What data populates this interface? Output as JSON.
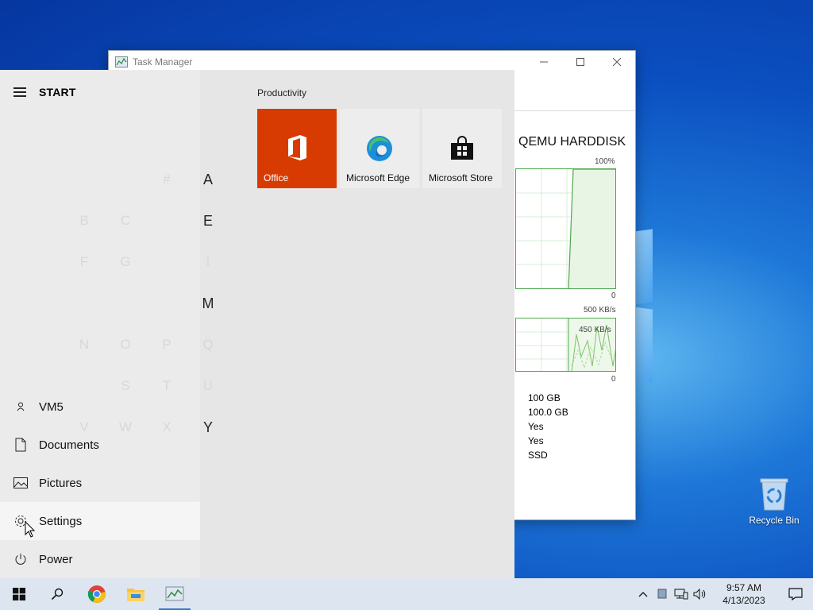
{
  "desktop": {
    "recycle_bin_label": "Recycle Bin"
  },
  "task_manager": {
    "title": "Task Manager",
    "disk_title": "QEMU HARDDISK",
    "graph1_max": "100%",
    "graph1_min": "0",
    "graph2_max": "500 KB/s",
    "graph2_mid": "450 KB/s",
    "graph2_min": "0",
    "properties": [
      "100 GB",
      "100.0 GB",
      "Yes",
      "Yes",
      "SSD"
    ]
  },
  "start_menu": {
    "title": "START",
    "letters_active": [
      "A",
      "E",
      "I",
      "M",
      "Q",
      "U",
      "Y"
    ],
    "letters_dim": [
      "#",
      "B",
      "C",
      "F",
      "G",
      "N",
      "O",
      "P",
      "S",
      "T",
      "V",
      "W",
      "X"
    ],
    "side_items": {
      "user": "VM5",
      "documents": "Documents",
      "pictures": "Pictures",
      "settings": "Settings",
      "power": "Power"
    },
    "group_title": "Productivity",
    "tiles": {
      "office": "Office",
      "edge": "Microsoft Edge",
      "store": "Microsoft Store"
    },
    "colors": {
      "office_tile": "#d83b01",
      "tile_bg": "#ededed"
    }
  },
  "taskbar": {
    "time": "9:57 AM",
    "date": "4/13/2023"
  }
}
